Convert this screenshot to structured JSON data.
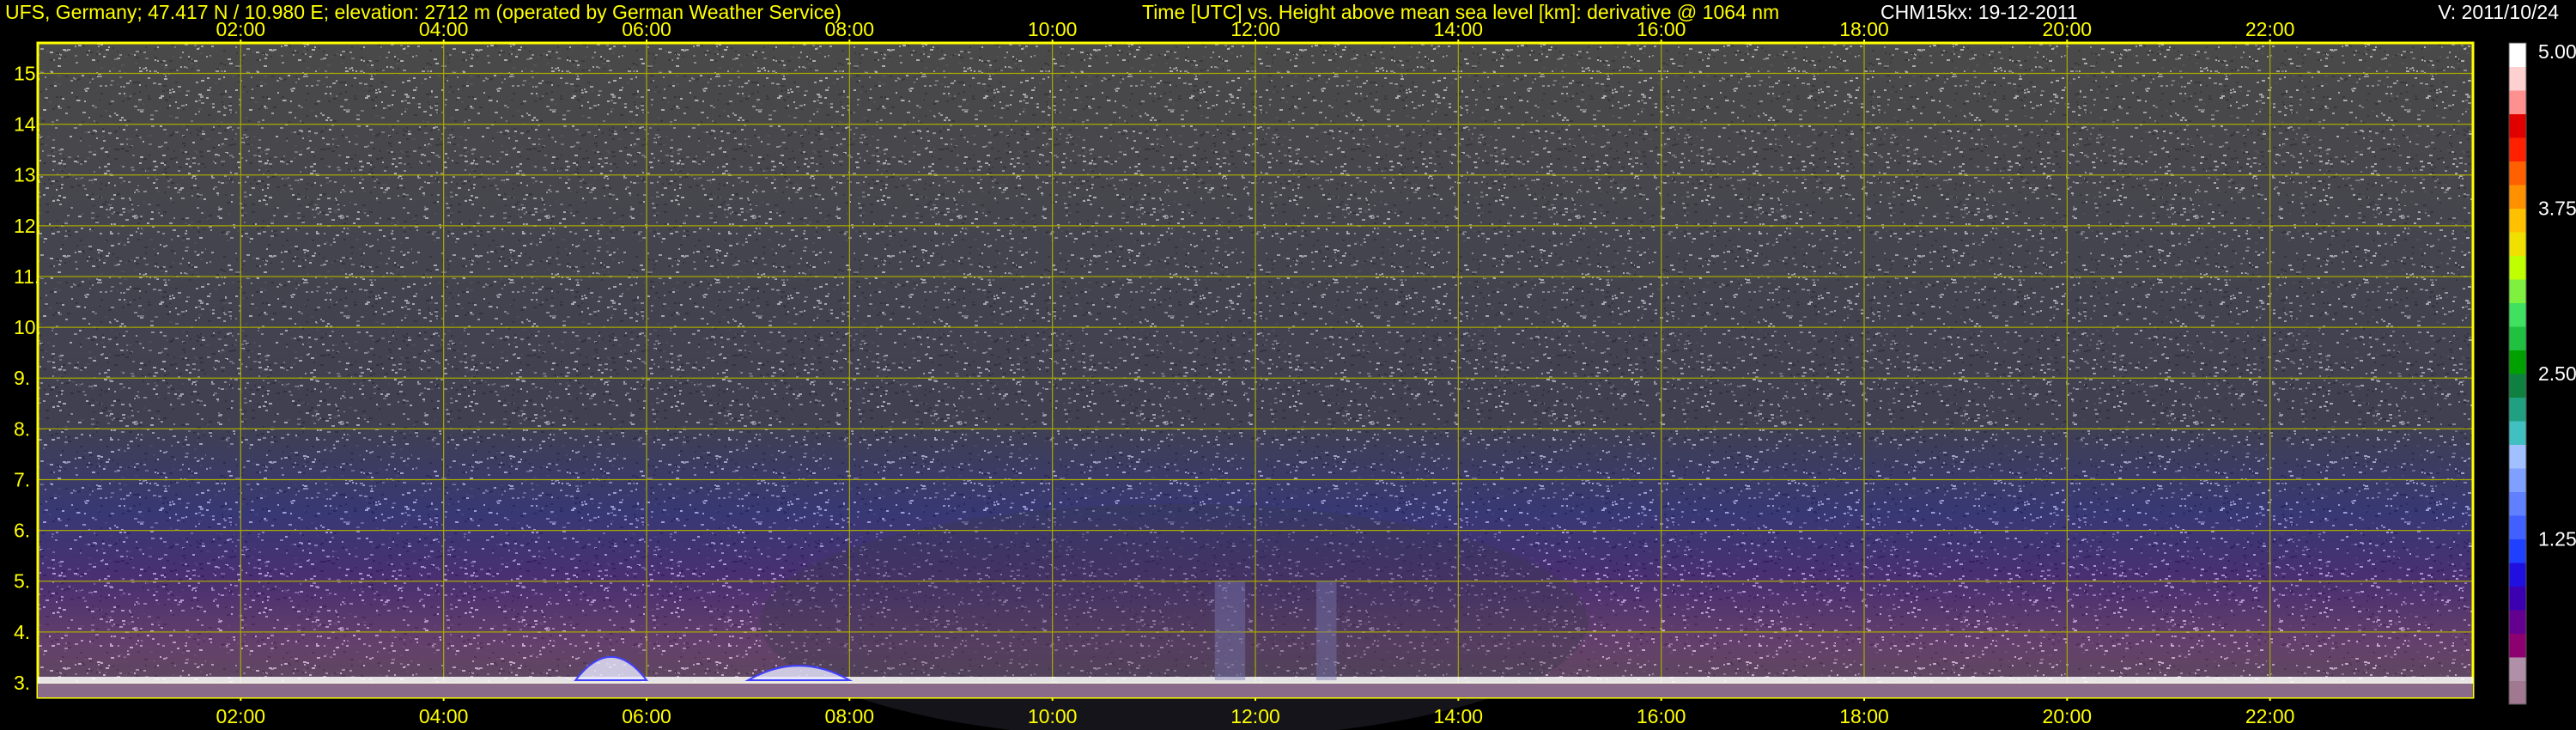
{
  "header": {
    "station": "UFS, Germany; 47.417 N / 10.980 E; elevation: 2712 m  (operated by German Weather Service)",
    "description": "Time [UTC] vs. Height above mean sea level [km]: derivative @ 1064 nm",
    "instrument": "CHM15kx: 19-12-2011",
    "version": "V: 2011/10/24"
  },
  "colors": {
    "axis_text": "#ffff00",
    "grid": "#a8a800",
    "frame": "#ffff00",
    "background": "#000000"
  },
  "chart_data": {
    "type": "heatmap",
    "title": "Time [UTC] vs. Height above mean sea level [km]: derivative @ 1064 nm",
    "xlabel": "Time [UTC]",
    "ylabel": "Height above mean sea level [km]",
    "x_ticks": [
      "02:00",
      "04:00",
      "06:00",
      "08:00",
      "10:00",
      "12:00",
      "14:00",
      "16:00",
      "18:00",
      "20:00",
      "22:00"
    ],
    "x_tick_hours": [
      2,
      4,
      6,
      8,
      10,
      12,
      14,
      16,
      18,
      20,
      22
    ],
    "xlim": [
      0,
      24
    ],
    "y_ticks": [
      "3.",
      "4.",
      "5.",
      "6.",
      "7.",
      "8.",
      "9.",
      "10.",
      "11.",
      "12.",
      "13.",
      "14.",
      "15."
    ],
    "y_tick_values": [
      3,
      4,
      5,
      6,
      7,
      8,
      9,
      10,
      11,
      12,
      13,
      14,
      15
    ],
    "ylim": [
      2.712,
      15.6
    ],
    "grid": true,
    "colorbar": {
      "ticks": [
        "5.00",
        "3.75",
        "2.50",
        "1.25"
      ],
      "tick_values": [
        5.0,
        3.75,
        2.5,
        1.25
      ],
      "range": [
        0,
        5.0
      ],
      "colors": [
        "#a07890",
        "#b090a8",
        "#8c0070",
        "#640090",
        "#3c00b0",
        "#2010e0",
        "#2040ff",
        "#4060ff",
        "#6080ff",
        "#80a0ff",
        "#a0c0ff",
        "#40c0c0",
        "#20a080",
        "#108040",
        "#00a000",
        "#20c040",
        "#40e060",
        "#80f040",
        "#c0ff00",
        "#f0e000",
        "#ffc000",
        "#ff9000",
        "#ff6000",
        "#ff2000",
        "#e00000",
        "#ff9090",
        "#ffd0d0",
        "#ffffff"
      ]
    },
    "features": [
      {
        "name": "low-level layer",
        "t_start": 0.0,
        "t_end": 24.0,
        "height_km": 3.05
      },
      {
        "name": "cloud return",
        "t_start": 5.3,
        "t_end": 6.0,
        "height_top_km": 3.8
      },
      {
        "name": "cloud return",
        "t_start": 7.0,
        "t_end": 8.0,
        "height_top_km": 3.45
      },
      {
        "name": "precipitation streak",
        "t_start": 11.6,
        "t_end": 11.9,
        "height_top_km": 5.0
      },
      {
        "name": "precipitation streak",
        "t_start": 12.6,
        "t_end": 12.8,
        "height_top_km": 5.0
      }
    ]
  }
}
